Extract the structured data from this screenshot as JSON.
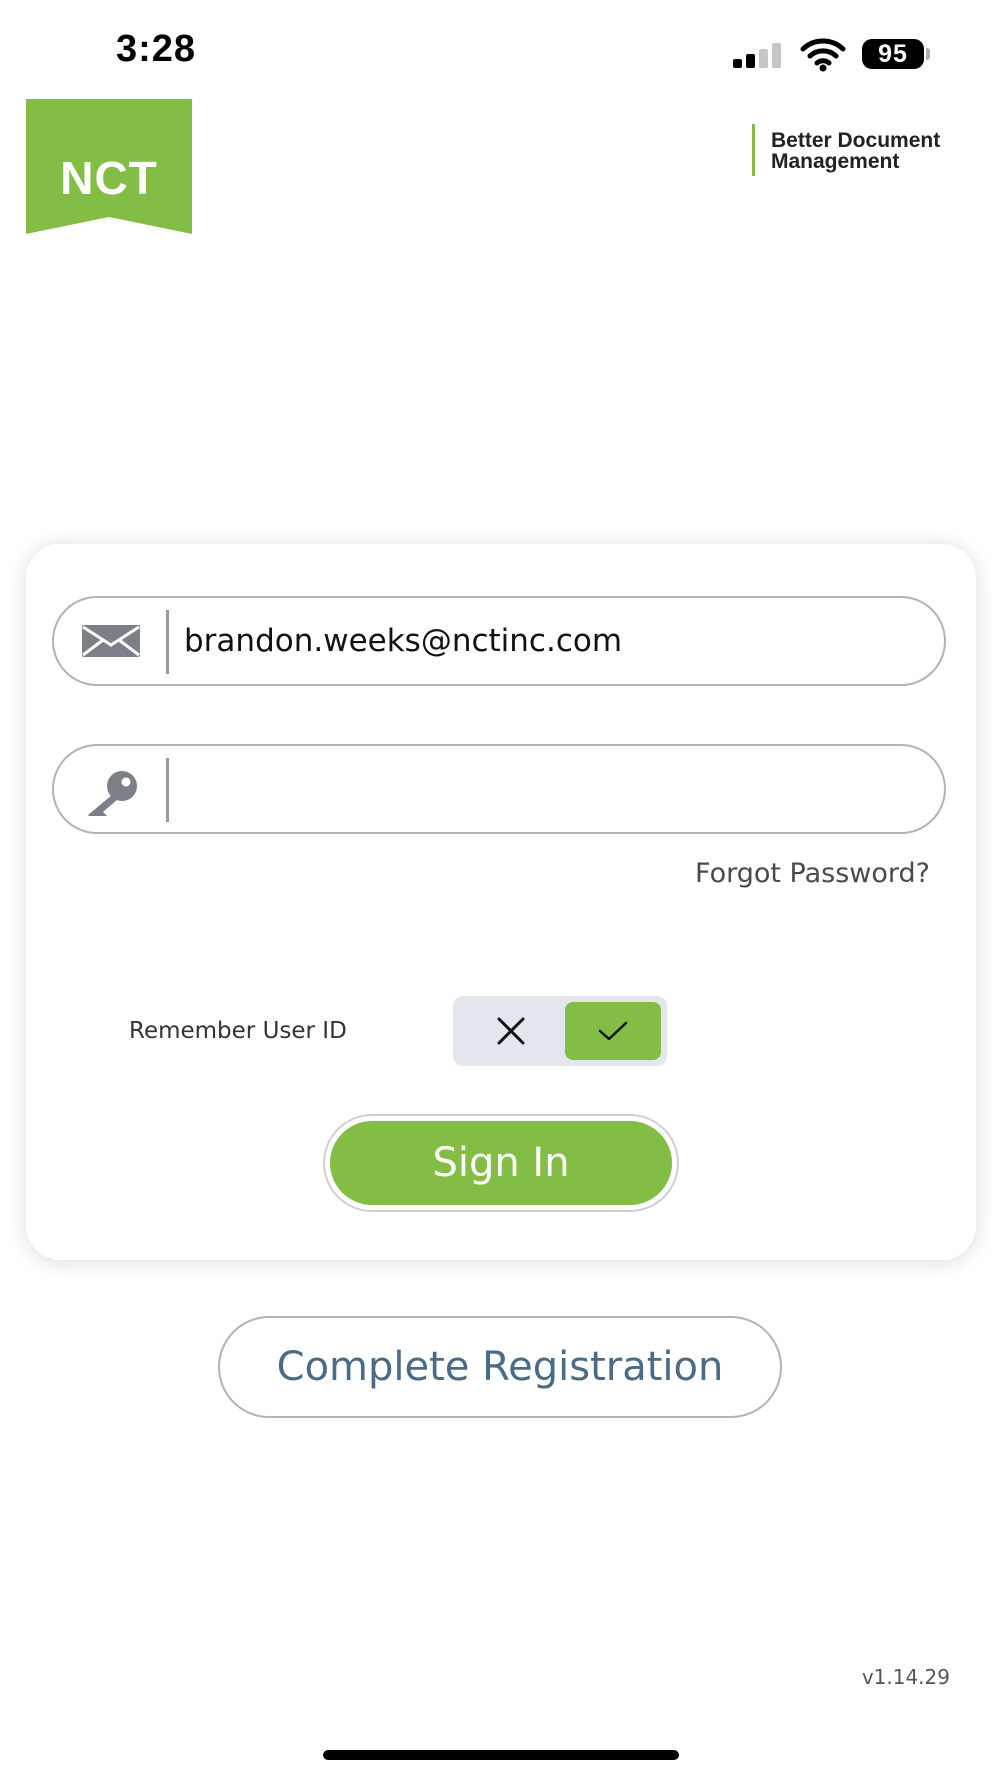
{
  "status_bar": {
    "time": "3:28",
    "battery": "95",
    "icons": [
      "cellular-signal-icon",
      "wifi-icon",
      "battery-icon"
    ]
  },
  "header": {
    "logo_text": "NCT",
    "tagline_line1": "Better Document",
    "tagline_line2": "Management"
  },
  "login": {
    "email_value": "brandon.weeks@nctinc.com",
    "password_value": "",
    "email_icon": "envelope-icon",
    "password_icon": "key-icon",
    "forgot_password": "Forgot Password?",
    "remember_label": "Remember User ID",
    "remember_enabled": true,
    "sign_in": "Sign In"
  },
  "register_label": "Complete Registration",
  "version": "v1.14.29",
  "colors": {
    "brand_green": "#84bd45",
    "register_text": "#4a6a86",
    "toggle_track": "#e4e6ed"
  }
}
